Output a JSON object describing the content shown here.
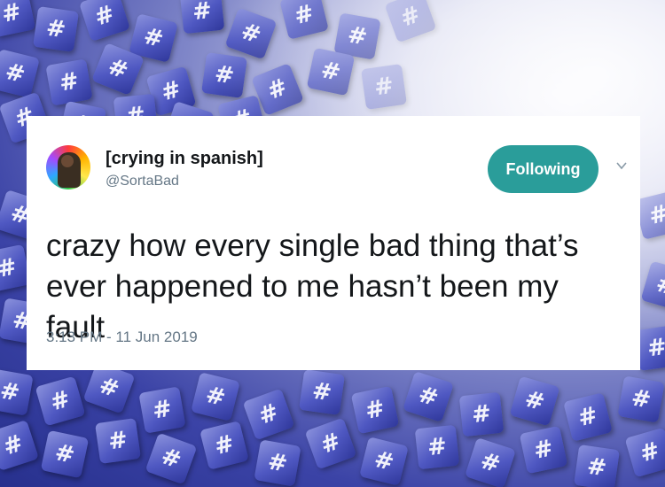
{
  "background": {
    "tile_symbol": "#",
    "tile_color": "#4f58c2",
    "description_icon": "hashtag-tile-icon"
  },
  "tweet": {
    "display_name": "[crying in spanish]",
    "handle": "@SortaBad",
    "follow_button_label": "Following",
    "follow_button_color": "#2a9d9a",
    "menu_icon": "chevron-down-icon",
    "text": "crazy how every single bad thing that’s ever happened to me hasn’t been my fault",
    "timestamp": "3:13 PM - 11 Jun 2019"
  }
}
